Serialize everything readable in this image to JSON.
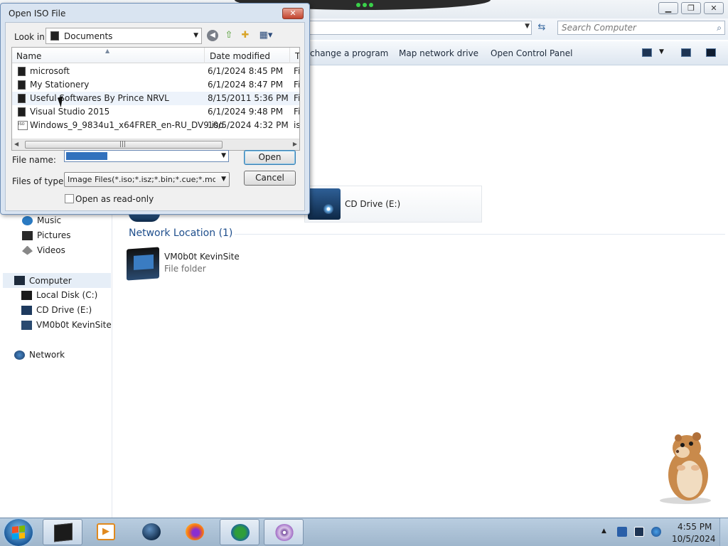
{
  "explorer": {
    "search_placeholder": "Search Computer",
    "commands": [
      "change a program",
      "Map network drive",
      "Open Control Panel"
    ],
    "sidebar": {
      "libraries": [
        {
          "label": "Music",
          "icon": "music-icon"
        },
        {
          "label": "Pictures",
          "icon": "pictures-icon"
        },
        {
          "label": "Videos",
          "icon": "videos-icon"
        }
      ],
      "computer": {
        "label": "Computer",
        "icon": "computer-icon"
      },
      "drives": [
        {
          "label": "Local Disk (C:)",
          "icon": "hard-disk-icon"
        },
        {
          "label": "CD Drive (E:)",
          "icon": "cd-drive-icon"
        },
        {
          "label": "VM0b0t KevinSite",
          "icon": "network-folder-icon"
        }
      ],
      "network": {
        "label": "Network",
        "icon": "network-icon"
      }
    },
    "cd_drive_tile": "CD Drive (E:)",
    "network_location_header": "Network Location (1)",
    "network_item": {
      "name": "VM0b0t KevinSite",
      "type": "File folder"
    }
  },
  "dialog": {
    "title": "Open ISO File",
    "close_label": "✕",
    "look_in_label": "Look in:",
    "look_in_value": "Documents",
    "columns": [
      "Name",
      "Date modified",
      "Ty"
    ],
    "files": [
      {
        "name": "microsoft",
        "date": "6/1/2024 8:45 PM",
        "type": "Fi",
        "icon": "folder-icon"
      },
      {
        "name": "My Stationery",
        "date": "6/1/2024 8:47 PM",
        "type": "Fi",
        "icon": "folder-icon"
      },
      {
        "name": "Useful Softwares By Prince NRVL",
        "date": "8/15/2011 5:36 PM",
        "type": "Fi",
        "icon": "folder-icon"
      },
      {
        "name": "Visual Studio 2015",
        "date": "6/1/2024 9:48 PM",
        "type": "Fi",
        "icon": "folder-icon"
      },
      {
        "name": "Windows_9_9834u1_x64FRER_en-RU_DV9.iso",
        "date": "10/5/2024 4:32 PM",
        "type": "is",
        "icon": "iso-file-icon"
      }
    ],
    "file_name_label": "File name:",
    "file_name_value": "",
    "files_of_type_label": "Files of type:",
    "files_of_type_value": "Image Files(*.iso;*.isz;*.bin;*.cue;*.mds;*.mdf;",
    "open_label": "Open",
    "cancel_label": "Cancel",
    "read_only_label": "Open as read-only",
    "read_only_checked": false
  },
  "taskbar": {
    "apps": [
      "explorer",
      "media-player",
      "globe",
      "firefox",
      "internet-download-manager",
      "disc-burner"
    ],
    "clock_time": "4:55 PM",
    "clock_date": "10/5/2024"
  }
}
